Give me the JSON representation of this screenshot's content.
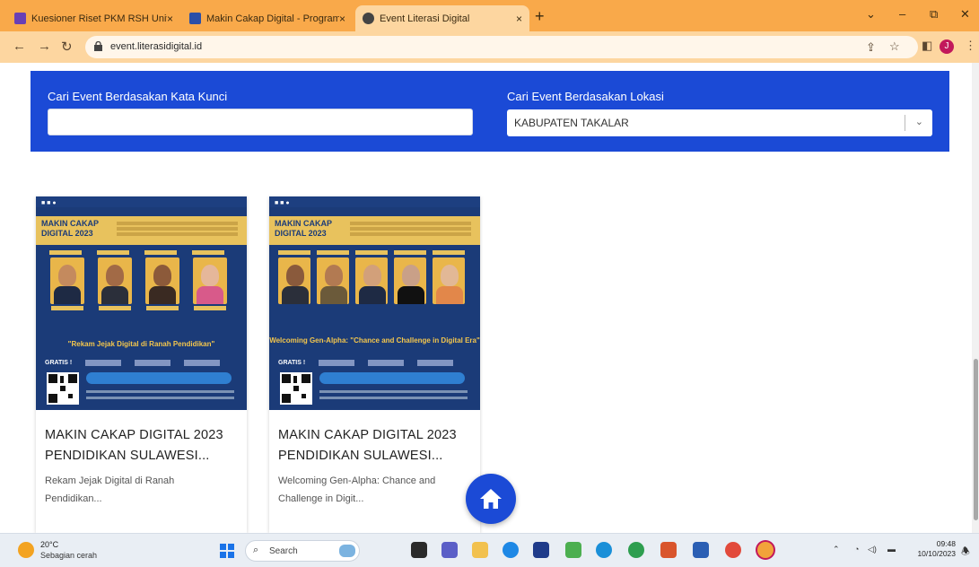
{
  "browser": {
    "tabs": [
      {
        "title": "Kuesioner Riset PKM RSH Unive",
        "close": "×"
      },
      {
        "title": "Makin Cakap Digital - Program",
        "close": "×"
      },
      {
        "title": "Event Literasi Digital",
        "close": "×"
      }
    ],
    "new_tab": "+",
    "window_controls": {
      "chevron": "⌄",
      "minimize": "–",
      "restore": "⧉",
      "close": "✕"
    },
    "url": "event.literasidigital.id",
    "profile_initial": "J",
    "colors": {
      "frame": "#f9a94a",
      "toolbar": "#fdd6a0"
    }
  },
  "search": {
    "keyword_label": "Cari Event Berdasakan Kata Kunci",
    "keyword_value": "",
    "location_label": "Cari Event Berdasakan Lokasi",
    "location_value": "KABUPATEN TAKALAR",
    "panel_color": "#1b4ad6"
  },
  "events": [
    {
      "poster_title": "MAKIN CAKAP DIGITAL 2023",
      "poster_subtitle": "\"Rekam Jejak Digital di Ranah Pendidikan\"",
      "gratis": "GRATIS !",
      "title": "MAKIN CAKAP DIGITAL 2023 PENDIDIKAN SULAWESI...",
      "description": "Rekam Jejak Digital di Ranah Pendidikan..."
    },
    {
      "poster_title": "MAKIN CAKAP DIGITAL 2023",
      "poster_subtitle": "Welcoming Gen-Alpha: \"Chance and Challenge in Digital Era\"",
      "gratis": "GRATIS !",
      "title": "MAKIN CAKAP DIGITAL 2023 PENDIDIKAN SULAWESI...",
      "description": "Welcoming Gen-Alpha: Chance and Challenge in Digit..."
    }
  ],
  "taskbar": {
    "temperature": "20°C",
    "weather": "Sebagian cerah",
    "search_placeholder": "Search",
    "time": "09:48",
    "date": "10/10/2023"
  }
}
